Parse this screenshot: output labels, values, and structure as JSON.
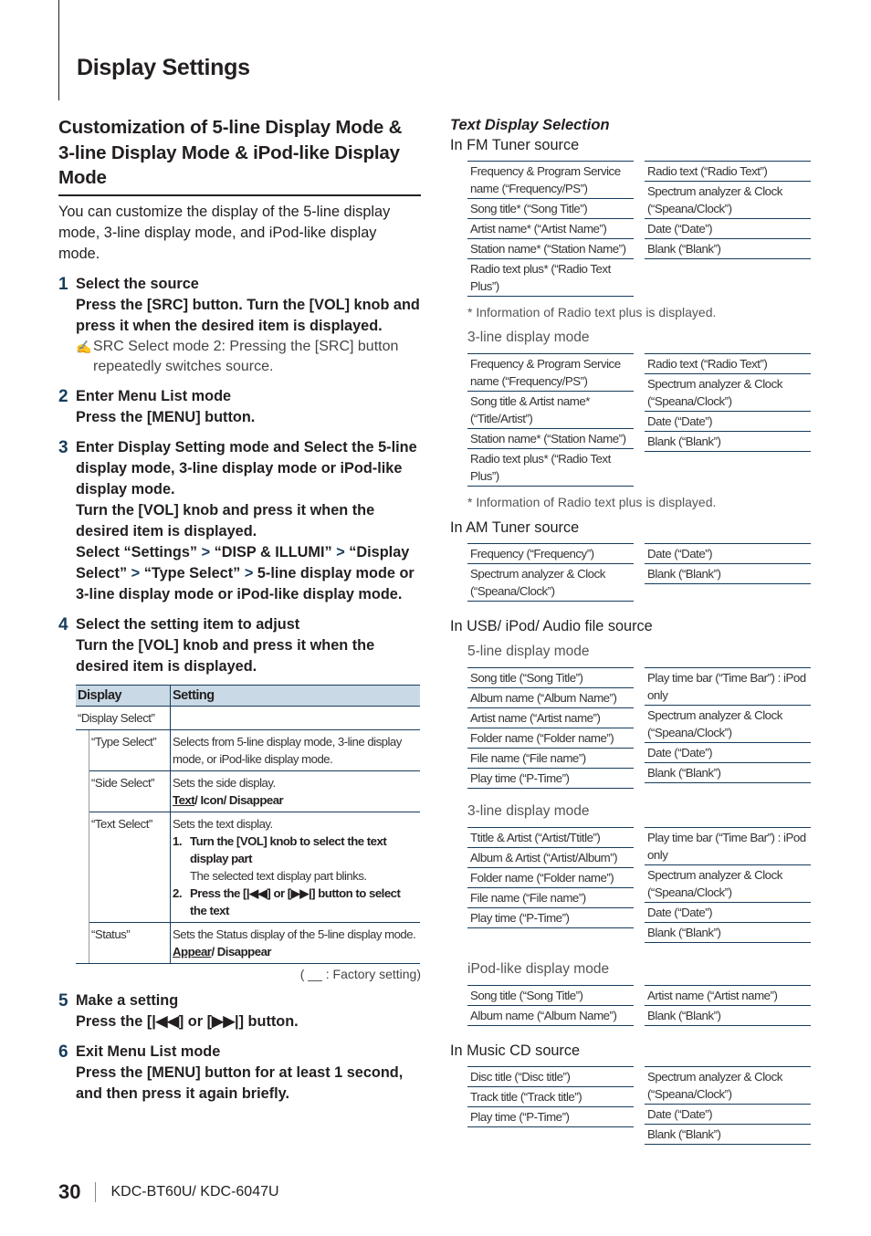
{
  "page": {
    "title": "Display Settings",
    "page_number": "30",
    "model": "KDC-BT60U/ KDC-6047U"
  },
  "left": {
    "section_title": "Customization of 5-line Display Mode & 3-line Display Mode & iPod-like Display Mode",
    "intro": "You can customize the display of the 5-line display mode, 3-line display mode, and iPod-like display mode.",
    "steps": [
      {
        "num": "1",
        "title": "Select the source",
        "body": "Press the [SRC] button. Turn the [VOL] knob and press it when the desired item is displayed.",
        "note": "SRC Select mode 2: Pressing the [SRC] button repeatedly switches source."
      },
      {
        "num": "2",
        "title": "Enter Menu List mode",
        "body": "Press the [MENU] button."
      },
      {
        "num": "3",
        "title": "Enter Display Setting mode and Select the 5-line display mode, 3-line display mode or iPod-like display mode.",
        "body": "Turn the [VOL] knob and press it when the desired item is displayed.",
        "path_prefix": "Select",
        "path": [
          "“Settings”",
          "“DISP & ILLUMI”",
          "“Display Select”",
          "“Type Select”",
          "5-line display mode or 3-line display mode or iPod-like display mode."
        ]
      },
      {
        "num": "4",
        "title": "Select the setting item to adjust",
        "body": "Turn the [VOL] knob and press it when the desired item is displayed."
      },
      {
        "num": "5",
        "title": "Make a setting",
        "body": "Press the [|◀◀] or [▶▶|] button."
      },
      {
        "num": "6",
        "title": "Exit Menu List mode",
        "body": "Press the [MENU] button for at least 1 second, and then press it again briefly."
      }
    ],
    "table": {
      "headers": [
        "Display",
        "Setting"
      ],
      "group": "“Display Select”",
      "rows": {
        "type_select": {
          "display": "“Type Select”",
          "setting": "Selects from 5-line display mode, 3-line display mode, or iPod-like display mode."
        },
        "side_select": {
          "display": "“Side Select”",
          "setting": "Sets the side display.",
          "default": "Text",
          "options_rest": "/ Icon/ Disappear"
        },
        "text_select": {
          "display": "“Text Select”",
          "setting": "Sets the text display.",
          "step1_num": "1.",
          "step1": "Turn the [VOL] knob to select the text display part",
          "step1_note": "The selected text display part blinks.",
          "step2_num": "2.",
          "step2": "Press the [|◀◀] or [▶▶|] button to select the text"
        },
        "status": {
          "display": "“Status”",
          "setting": "Sets the Status display of the 5-line display mode.",
          "default": "Appear",
          "options_rest": "/ Disappear"
        }
      },
      "factory_note": "( __ : Factory setting)"
    }
  },
  "right": {
    "subtitle": "Text Display Selection",
    "fm": {
      "title": "In FM Tuner source",
      "five_line": {
        "left": [
          "Frequency & Program Service name (“Frequency/PS”)",
          "Song title* (“Song Title”)",
          "Artist name* (“Artist Name”)",
          "Station name* (“Station Name”)",
          "Radio text plus* (“Radio Text Plus”)"
        ],
        "right": [
          "Radio text (“Radio Text”)",
          "Spectrum analyzer & Clock (“Speana/Clock”)",
          "Date (“Date”)",
          "Blank (“Blank”)"
        ]
      },
      "footnote1": "*  Information of Radio text plus is displayed.",
      "three_line_title": "3-line display mode",
      "three_line": {
        "left": [
          "Frequency & Program Service name (“Frequency/PS”)",
          "Song title & Artist name* (“Title/Artist”)",
          "Station name* (“Station Name”)",
          "Radio text plus* (“Radio Text Plus”)"
        ],
        "right": [
          "Radio text (“Radio Text”)",
          "Spectrum analyzer & Clock (“Speana/Clock”)",
          "Date (“Date”)",
          "Blank (“Blank”)"
        ]
      },
      "footnote2": "*  Information of Radio text plus is displayed."
    },
    "am": {
      "title": "In AM Tuner source",
      "left": [
        "Frequency (“Frequency”)",
        "Spectrum analyzer & Clock (“Speana/Clock”)"
      ],
      "right": [
        "Date (“Date”)",
        "Blank (“Blank”)"
      ]
    },
    "usb": {
      "title": "In USB/ iPod/ Audio file source",
      "five_line_title": "5-line display mode",
      "five_line": {
        "left": [
          "Song title (“Song Title”)",
          "Album name (“Album Name”)",
          "Artist name (“Artist name”)",
          "Folder name (“Folder name”)",
          "File name (“File name”)",
          "Play time (“P-Time”)"
        ],
        "right": [
          "Play time bar (“Time Bar”) : iPod only",
          "Spectrum analyzer & Clock (“Speana/Clock”)",
          "Date (“Date”)",
          "Blank (“Blank”)"
        ]
      },
      "three_line_title": "3-line display mode",
      "three_line": {
        "left": [
          "Ttitle & Artist (“Artist/Ttitle”)",
          "Album & Artist (“Artist/Album”)",
          "Folder name (“Folder name”)",
          "File name (“File name”)",
          "Play time (“P-Time”)"
        ],
        "right": [
          "Play time bar (“Time Bar”) : iPod only",
          "Spectrum analyzer & Clock (“Speana/Clock”)",
          "Date (“Date”)",
          "Blank (“Blank”)"
        ]
      },
      "ipod_title": "iPod-like display mode",
      "ipod": {
        "left": [
          "Song title (“Song Title”)",
          "Album name (“Album Name”)"
        ],
        "right": [
          "Artist name (“Artist name”)",
          "Blank (“Blank”)"
        ]
      }
    },
    "cd": {
      "title": "In Music CD source",
      "left": [
        "Disc title (“Disc title”)",
        "Track title (“Track title”)",
        "Play time (“P-Time”)"
      ],
      "right": [
        "Spectrum analyzer & Clock (“Speana/Clock”)",
        "Date (“Date”)",
        "Blank (“Blank”)"
      ]
    }
  }
}
